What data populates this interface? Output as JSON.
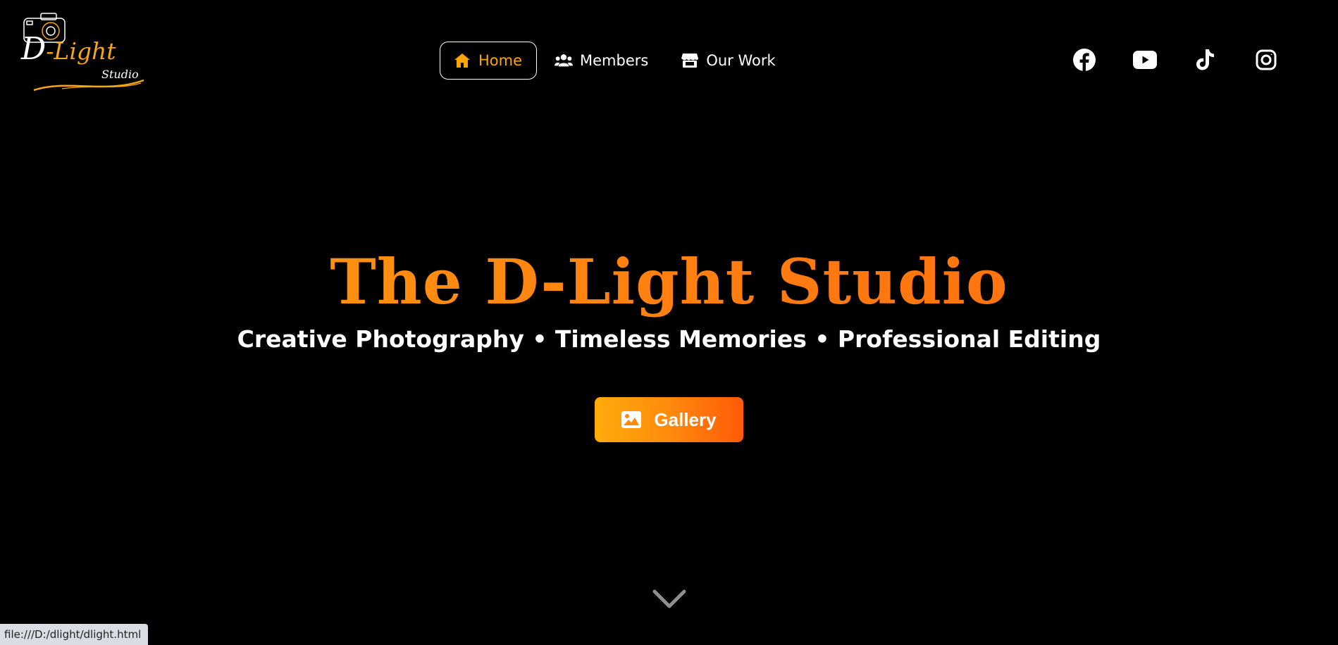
{
  "logo": {
    "main_d": "D",
    "main_rest": "-Light",
    "sub": "Studio"
  },
  "nav": {
    "items": [
      {
        "label": "Home",
        "icon": "home-icon",
        "active": true
      },
      {
        "label": "Members",
        "icon": "users-icon",
        "active": false
      },
      {
        "label": "Our Work",
        "icon": "store-icon",
        "active": false
      }
    ]
  },
  "social": [
    "facebook-icon",
    "youtube-icon",
    "tiktok-icon",
    "instagram-icon"
  ],
  "hero": {
    "title": "The D-Light Studio",
    "subtitle": "Creative Photography • Timeless Memories • Professional Editing",
    "button_label": "Gallery"
  },
  "status_bar": {
    "url": "file:///D:/dlight/dlight.html"
  },
  "colors": {
    "accent": "#ffa500",
    "gradient_start": "#ffab0b",
    "gradient_end": "#ff5a08",
    "background": "#000000"
  }
}
